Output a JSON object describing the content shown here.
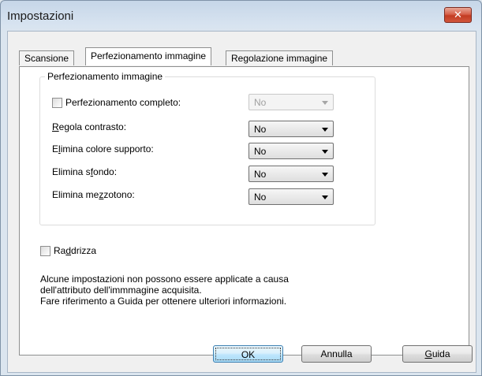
{
  "window": {
    "title": "Impostazioni",
    "close_glyph": "✕"
  },
  "tabs": [
    {
      "label": "Scansione"
    },
    {
      "label": "Perfezionamento immagine",
      "active": true
    },
    {
      "label": "Regolazione immagine"
    }
  ],
  "group": {
    "legend": "Perfezionamento immagine",
    "full": {
      "label": "Perfezionamento completo:",
      "checked": false,
      "value": "No"
    },
    "rows": [
      {
        "pre": "",
        "acc": "R",
        "post": "egola contrasto:",
        "value": "No"
      },
      {
        "pre": "E",
        "acc": "l",
        "post": "imina colore supporto:",
        "value": "No"
      },
      {
        "pre": "Elimina s",
        "acc": "f",
        "post": "ondo:",
        "value": "No"
      },
      {
        "pre": "Elimina me",
        "acc": "z",
        "post": "zotono:",
        "value": "No"
      }
    ]
  },
  "straighten": {
    "pre": "Ra",
    "acc": "d",
    "post": "drizza",
    "checked": false
  },
  "note": {
    "line1": "Alcune impostazioni non possono essere applicate a causa",
    "line2": "dell'attributo dell'immmagine acquisita.",
    "line3": "Fare riferimento a Guida per ottenere ulteriori informazioni."
  },
  "buttons": {
    "ok": "OK",
    "cancel": "Annulla",
    "help_acc": "G",
    "help_post": "uida"
  },
  "icons": {
    "close": "close-icon",
    "dropdown": "chevron-down-icon",
    "checkbox": "checkbox-unchecked"
  }
}
